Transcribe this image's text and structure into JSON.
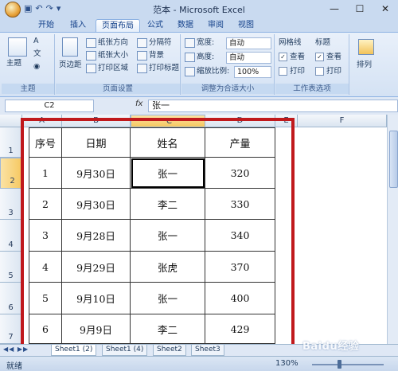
{
  "window": {
    "title": "范本 - Microsoft Excel",
    "controls": [
      "—",
      "☐",
      "✕"
    ]
  },
  "tabs": [
    {
      "label": "开始",
      "active": false
    },
    {
      "label": "插入",
      "active": false
    },
    {
      "label": "页面布局",
      "active": true
    },
    {
      "label": "公式",
      "active": false
    },
    {
      "label": "数据",
      "active": false
    },
    {
      "label": "审阅",
      "active": false
    },
    {
      "label": "视图",
      "active": false
    }
  ],
  "ribbon": {
    "theme": {
      "label": "主题",
      "btn": "主题",
      "sub": [
        "A",
        "文",
        "◉"
      ]
    },
    "page_setup": {
      "label": "页面设置",
      "margins": "页边距",
      "orientation": "纸张方向",
      "size": "纸张大小",
      "print_area": "打印区域",
      "breaks": "分隔符",
      "background": "背景",
      "print_titles": "打印标题"
    },
    "scale": {
      "label": "调整为合适大小",
      "width_label": "宽度:",
      "width_value": "自动",
      "height_label": "高度:",
      "height_value": "自动",
      "scale_label": "缩放比例:",
      "scale_value": "100%"
    },
    "sheet_options": {
      "label": "工作表选项",
      "gridlines": "网格线",
      "headings": "标题",
      "view": "查看",
      "print": "打印"
    },
    "arrange": {
      "label": "排列"
    }
  },
  "formula_bar": {
    "name_box": "C2",
    "fx": "fx",
    "content": "张一"
  },
  "columns": [
    "A",
    "B",
    "C",
    "D",
    "E",
    "F"
  ],
  "rows": [
    "1",
    "2",
    "3",
    "4",
    "5",
    "6",
    "7"
  ],
  "table": {
    "headers": [
      "序号",
      "日期",
      "姓名",
      "产量"
    ],
    "rows": [
      [
        "1",
        "9月30日",
        "张一",
        "320"
      ],
      [
        "2",
        "9月30日",
        "李二",
        "330"
      ],
      [
        "3",
        "9月28日",
        "张一",
        "340"
      ],
      [
        "4",
        "9月29日",
        "张虎",
        "370"
      ],
      [
        "5",
        "9月10日",
        "张一",
        "400"
      ],
      [
        "6",
        "9月9日",
        "李二",
        "429"
      ]
    ]
  },
  "sheets": [
    {
      "label": "Sheet1 (2)",
      "active": true
    },
    {
      "label": "Sheet1 (4)",
      "active": false
    },
    {
      "label": "Sheet2",
      "active": false
    },
    {
      "label": "Sheet3",
      "active": false
    }
  ],
  "status": {
    "ready": "就绪",
    "zoom": "130%"
  },
  "watermark": "Baidu经验"
}
